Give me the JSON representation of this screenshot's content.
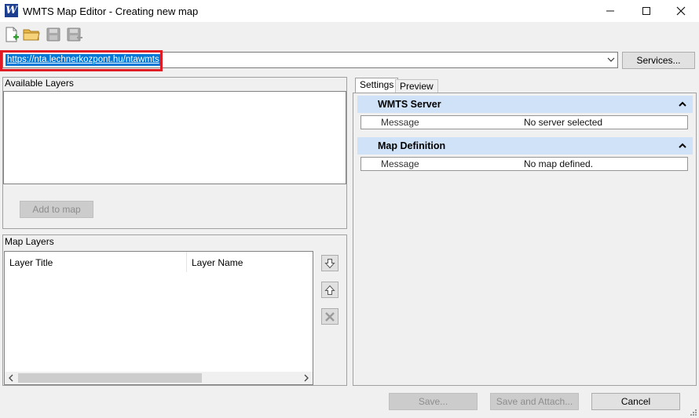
{
  "window": {
    "title": "WMTS Map Editor - Creating new map",
    "minimize_glyph": "—",
    "maximize_glyph": "☐",
    "close_glyph": "✕"
  },
  "toolbar": {
    "icons": [
      "new-map-icon",
      "open-folder-icon",
      "save-icon",
      "save-as-icon"
    ]
  },
  "server_url": {
    "value": "https://nta.lechnerkozpont.hu/ntawmts",
    "services_label": "Services..."
  },
  "available_layers": {
    "label": "Available Layers",
    "add_to_map_label": "Add to map"
  },
  "map_layers": {
    "label": "Map Layers",
    "columns": [
      "Layer Title",
      "Layer Name"
    ]
  },
  "tabs": {
    "settings": "Settings",
    "preview": "Preview",
    "active": "Settings"
  },
  "settings": {
    "wmts_server": {
      "header": "WMTS Server",
      "message_key": "Message",
      "message_value": "No server selected"
    },
    "map_definition": {
      "header": "Map Definition",
      "message_key": "Message",
      "message_value": "No map defined."
    }
  },
  "footer": {
    "save_label": "Save...",
    "save_attach_label": "Save and Attach...",
    "cancel_label": "Cancel"
  },
  "colors": {
    "accent": "#0078d7",
    "highlight_box": "#e01b24",
    "section_header_bg": "#cfe2f8"
  }
}
